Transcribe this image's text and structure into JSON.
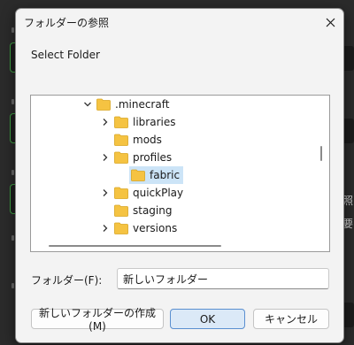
{
  "dialog": {
    "title": "フォルダーの参照",
    "prompt": "Select Folder",
    "folder_label": "フォルダー(F):",
    "folder_value": "新しいフォルダー",
    "buttons": {
      "new_folder": "新しいフォルダーの作成(M)",
      "ok": "OK",
      "cancel": "キャンセル"
    }
  },
  "tree": {
    "items": [
      {
        "label": ".minecraft",
        "state": "expanded"
      },
      {
        "label": "libraries",
        "state": "collapsed"
      },
      {
        "label": "mods",
        "state": "leaf"
      },
      {
        "label": "profiles",
        "state": "expanded"
      },
      {
        "label": "fabric",
        "state": "selected"
      },
      {
        "label": "quickPlay",
        "state": "collapsed"
      },
      {
        "label": "staging",
        "state": "leaf"
      },
      {
        "label": "versions",
        "state": "collapsed"
      }
    ]
  },
  "background": {
    "side_text_1": "照",
    "side_text_2": "要"
  },
  "colors": {
    "folder": "#f5c342",
    "selection": "#cce4f7",
    "accent_border": "#3fa345",
    "primary_button_border": "#5a8fd0"
  }
}
